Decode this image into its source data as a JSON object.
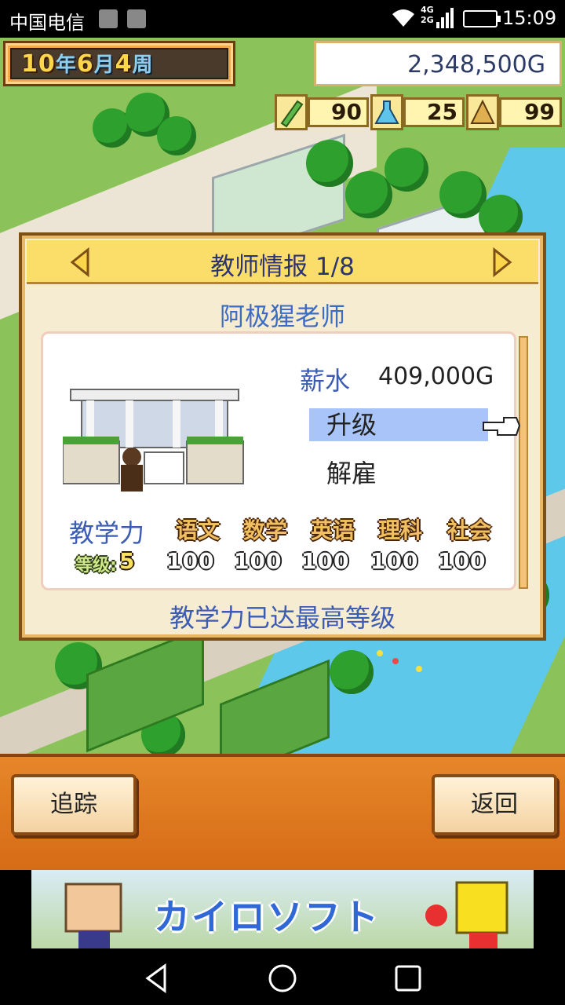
{
  "status_bar": {
    "carrier": "中国电信",
    "network": [
      "4G",
      "2G"
    ],
    "time": "15:09"
  },
  "hud": {
    "date": {
      "year": "10",
      "year_unit": "年",
      "month": "6",
      "month_unit": "月",
      "week": "4",
      "week_unit": "周"
    },
    "money": "2,348,500G",
    "stats": [
      {
        "icon": "pencil-icon",
        "value": "90"
      },
      {
        "icon": "flask-icon",
        "value": "25"
      },
      {
        "icon": "pyramid-icon",
        "value": "99"
      }
    ]
  },
  "panel": {
    "title": "教师情报 1/8",
    "teacher_name": "阿极猩老师",
    "salary_label": "薪水",
    "salary_value": "409,000G",
    "options": {
      "upgrade": "升级",
      "fire": "解雇"
    },
    "teaching_label": "教学力",
    "subjects": [
      "语文",
      "数学",
      "英语",
      "理科",
      "社会"
    ],
    "level_label": "等级:",
    "level_value": "5",
    "scores": [
      "100",
      "100",
      "100",
      "100",
      "100"
    ],
    "max_message": "教学力已达最高等级"
  },
  "buttons": {
    "track": "追踪",
    "back": "返回"
  },
  "ad": {
    "logo_text": "カイロソフト"
  },
  "colors": {
    "accent_blue": "#3c5cb4",
    "highlight": "#a9c4f8",
    "wood": "#e6862a"
  }
}
